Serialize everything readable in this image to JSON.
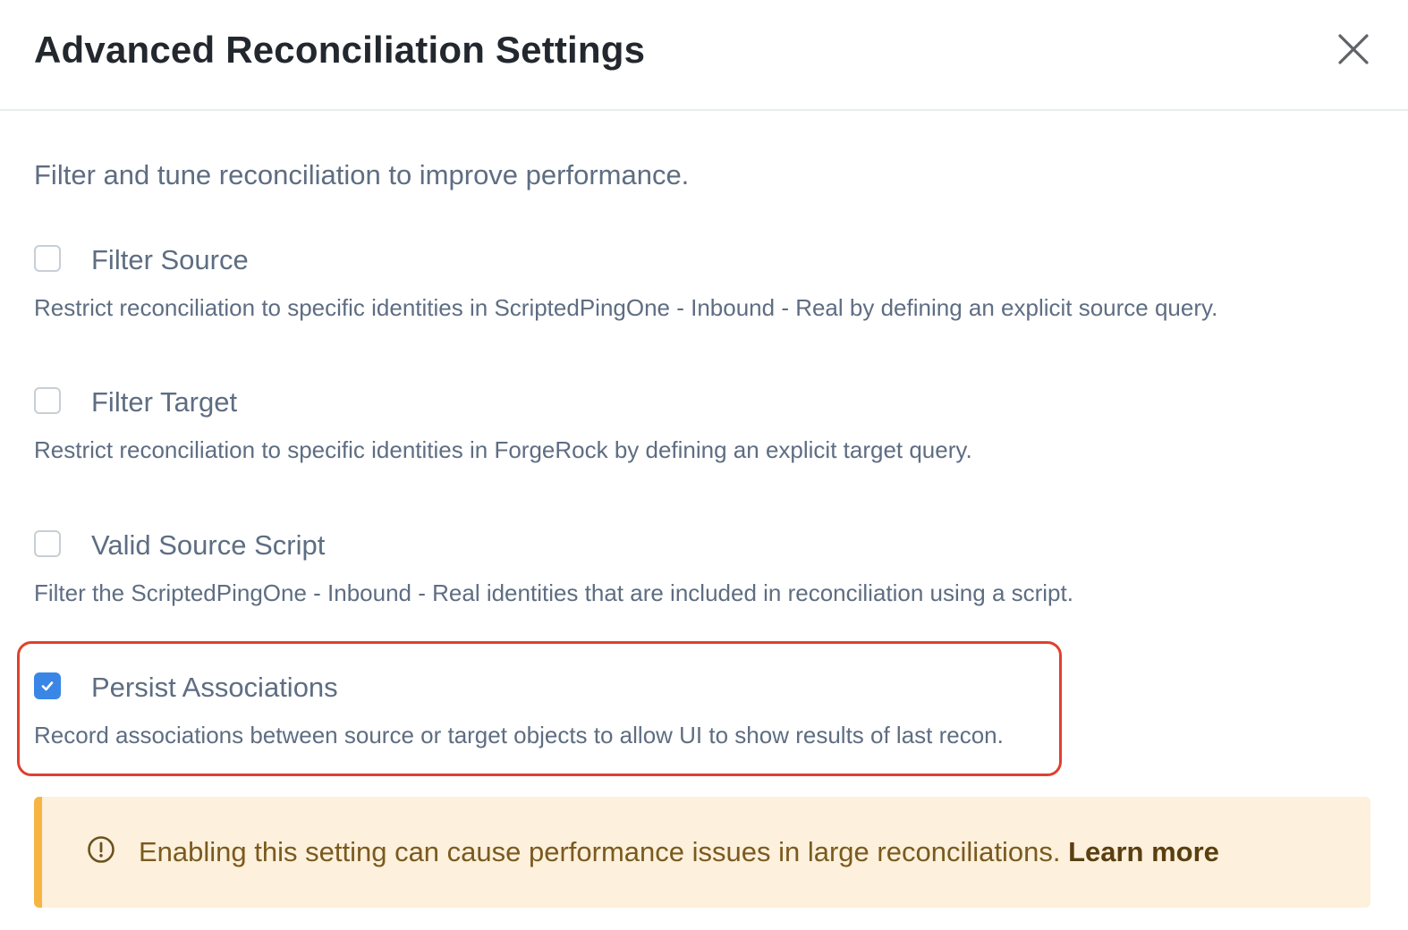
{
  "modal": {
    "title": "Advanced Reconciliation Settings",
    "close_icon": "close-icon"
  },
  "intro": "Filter and tune reconciliation to improve performance.",
  "options": [
    {
      "label": "Filter Source",
      "description": "Restrict reconciliation to specific identities in ScriptedPingOne - Inbound - Real by defining an explicit source query.",
      "checked": false
    },
    {
      "label": "Filter Target",
      "description": "Restrict reconciliation to specific identities in ForgeRock by defining an explicit target query.",
      "checked": false
    },
    {
      "label": "Valid Source Script",
      "description": "Filter the ScriptedPingOne - Inbound - Real identities that are included in reconciliation using a script.",
      "checked": false
    },
    {
      "label": "Persist Associations",
      "description": "Record associations between source or target objects to allow UI to show results of last recon.",
      "checked": true
    }
  ],
  "alert": {
    "icon": "alert-circle-icon",
    "message": "Enabling this setting can cause performance issues in large reconciliations.",
    "link_label": "Learn more"
  },
  "colors": {
    "title": "#23282e",
    "body_text": "#5e6d82",
    "checkbox_checked": "#3a86e6",
    "highlight": "#e0402f",
    "alert_bg": "#fdf0dc",
    "alert_border": "#f6b443",
    "alert_text": "#7a5a1e"
  }
}
